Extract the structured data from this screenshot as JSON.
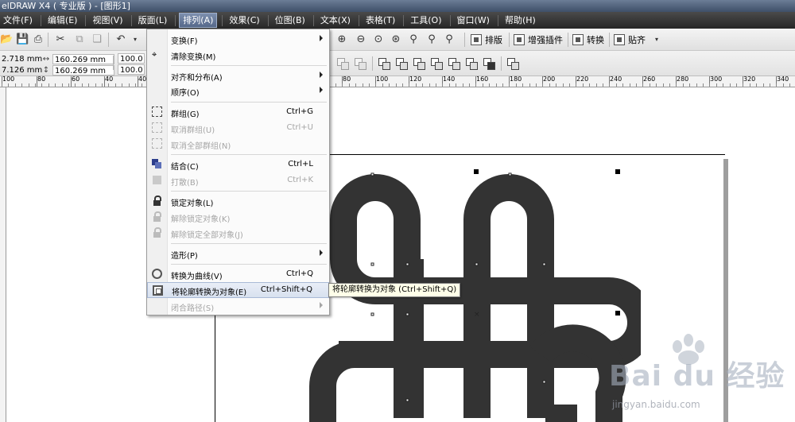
{
  "window": {
    "title": "elDRAW X4 ( 专业版 ) - [图形1]"
  },
  "menubar": [
    {
      "label": "文件(F)",
      "active": false
    },
    {
      "label": "编辑(E)",
      "active": false
    },
    {
      "label": "视图(V)",
      "active": false
    },
    {
      "label": "版面(L)",
      "active": false
    },
    {
      "label": "排列(A)",
      "active": true
    },
    {
      "label": "效果(C)",
      "active": false
    },
    {
      "label": "位图(B)",
      "active": false
    },
    {
      "label": "文本(X)",
      "active": false
    },
    {
      "label": "表格(T)",
      "active": false
    },
    {
      "label": "工具(O)",
      "active": false
    },
    {
      "label": "窗口(W)",
      "active": false
    },
    {
      "label": "帮助(H)",
      "active": false
    }
  ],
  "toolbar": {
    "labels": {
      "layout": "排版",
      "plugins": "增强插件",
      "convert": "转换",
      "paste": "贴齐"
    }
  },
  "properties": {
    "x": "2.718 mm",
    "y": "7.126 mm",
    "width": "160.269 mm",
    "height": "160.269 mm",
    "scale_w": "100.0",
    "scale_h": "100.0"
  },
  "ruler": {
    "left_ticks": [
      "100",
      "80",
      "60",
      "40"
    ],
    "right_ticks": [
      "80",
      "100",
      "120",
      "140",
      "160",
      "180",
      "200",
      "220",
      "240",
      "260",
      "280",
      "300",
      "320",
      "340"
    ]
  },
  "arrange_menu": {
    "items": [
      {
        "label": "变换(F)",
        "shortcut": "",
        "submenu": true,
        "disabled": false,
        "icon": ""
      },
      {
        "label": "清除变换(M)",
        "shortcut": "",
        "submenu": false,
        "disabled": false,
        "icon": "clear-transform-icon"
      },
      {
        "label": "对齐和分布(A)",
        "shortcut": "",
        "submenu": true,
        "disabled": false,
        "icon": ""
      },
      {
        "label": "顺序(O)",
        "shortcut": "",
        "submenu": true,
        "disabled": false,
        "icon": ""
      },
      {
        "label": "群组(G)",
        "shortcut": "Ctrl+G",
        "submenu": false,
        "disabled": false,
        "icon": "group-icon"
      },
      {
        "label": "取消群组(U)",
        "shortcut": "Ctrl+U",
        "submenu": false,
        "disabled": true,
        "icon": "ungroup-icon"
      },
      {
        "label": "取消全部群组(N)",
        "shortcut": "",
        "submenu": false,
        "disabled": true,
        "icon": "ungroup-all-icon"
      },
      {
        "label": "结合(C)",
        "shortcut": "Ctrl+L",
        "submenu": false,
        "disabled": false,
        "icon": "combine-icon"
      },
      {
        "label": "打散(B)",
        "shortcut": "Ctrl+K",
        "submenu": false,
        "disabled": true,
        "icon": "break-apart-icon"
      },
      {
        "label": "锁定对象(L)",
        "shortcut": "",
        "submenu": false,
        "disabled": false,
        "icon": "lock-icon"
      },
      {
        "label": "解除锁定对象(K)",
        "shortcut": "",
        "submenu": false,
        "disabled": true,
        "icon": "unlock-icon"
      },
      {
        "label": "解除锁定全部对象(J)",
        "shortcut": "",
        "submenu": false,
        "disabled": true,
        "icon": "unlock-all-icon"
      },
      {
        "label": "造形(P)",
        "shortcut": "",
        "submenu": true,
        "disabled": false,
        "icon": ""
      },
      {
        "label": "转换为曲线(V)",
        "shortcut": "Ctrl+Q",
        "submenu": false,
        "disabled": false,
        "icon": "convert-to-curves-icon"
      },
      {
        "label": "将轮廓转换为对象(E)",
        "shortcut": "Ctrl+Shift+Q",
        "submenu": false,
        "disabled": false,
        "icon": "outline-to-object-icon",
        "hover": true
      },
      {
        "label": "闭合路径(S)",
        "shortcut": "",
        "submenu": true,
        "disabled": true,
        "icon": ""
      }
    ]
  },
  "tooltip": {
    "text": "将轮廓转换为对象 (Ctrl+Shift+Q)"
  },
  "watermark": {
    "brand": "Bai du 经验",
    "url": "jingyan.baidu.com"
  },
  "colors": {
    "knot": "#333333",
    "menubar": "#2b2b2b",
    "menu_highlight": "#d8e1ef"
  }
}
